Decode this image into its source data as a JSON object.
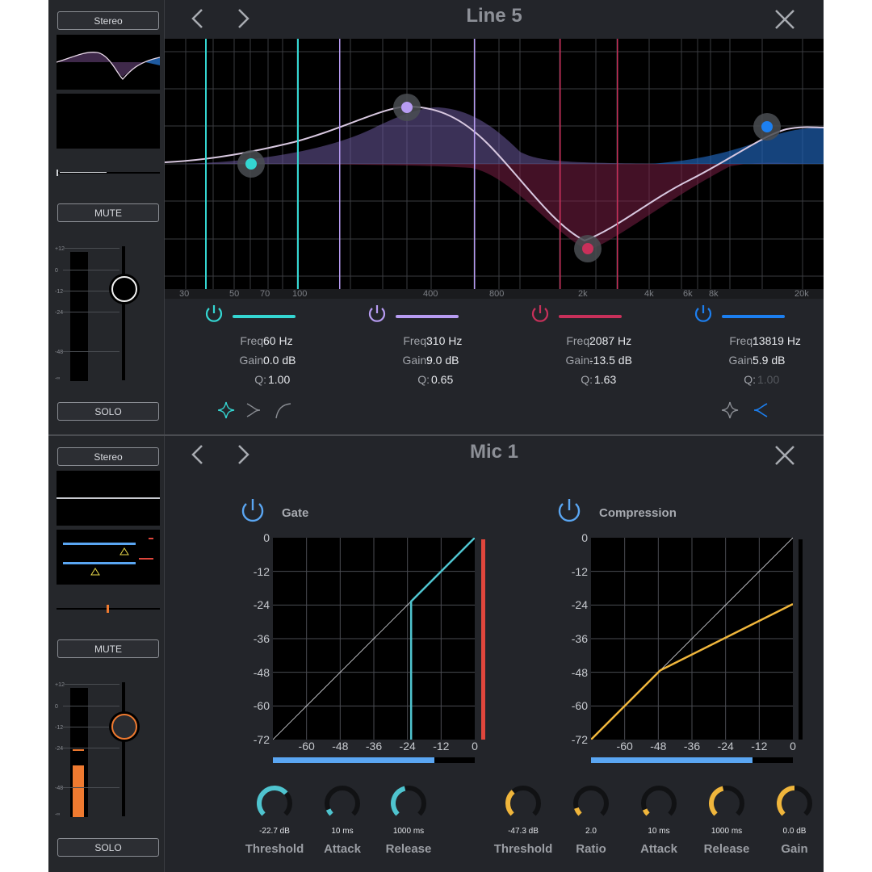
{
  "top": {
    "title": "Line 5",
    "strip": {
      "stereo": "Stereo",
      "mute": "MUTE",
      "solo": "SOLO",
      "scale": [
        "+12",
        "0",
        "-12",
        "-24",
        "-48",
        "-∞"
      ]
    },
    "eq": {
      "freq_ticks": [
        "30",
        "50",
        "70",
        "100",
        "400",
        "800",
        "2k",
        "4k",
        "6k",
        "8k",
        "20k"
      ],
      "bands": [
        {
          "color": "#34d6d2",
          "freq": "60 Hz",
          "gain": "0.0 dB",
          "q": "1.00"
        },
        {
          "color": "#b79cf2",
          "freq": "310 Hz",
          "gain": "9.0 dB",
          "q": "0.65"
        },
        {
          "color": "#c8305a",
          "freq": "2087 Hz",
          "gain": "-13.5 dB",
          "q": "1.63"
        },
        {
          "color": "#1c7ff0",
          "freq": "13819 Hz",
          "gain": "5.9 dB",
          "q": "1.00"
        }
      ],
      "labels": {
        "freq": "Freq:",
        "gain": "Gain:",
        "q": "Q:"
      }
    }
  },
  "bottom": {
    "title": "Mic 1",
    "strip": {
      "stereo": "Stereo",
      "mute": "MUTE",
      "solo": "SOLO",
      "scale": [
        "+12",
        "0",
        "-12",
        "-24",
        "-48",
        "-∞"
      ]
    },
    "gate": {
      "label": "Gate",
      "y_ticks": [
        "0",
        "-12",
        "-24",
        "-36",
        "-48",
        "-60",
        "-72"
      ],
      "x_ticks": [
        "-60",
        "-48",
        "-36",
        "-24",
        "-12",
        "0"
      ],
      "threshold_db": -22.7,
      "knobs": [
        {
          "value": "-22.7 dB",
          "label": "Threshold",
          "level": 0.68
        },
        {
          "value": "10 ms",
          "label": "Attack",
          "level": 0.08
        },
        {
          "value": "1000 ms",
          "label": "Release",
          "level": 0.45
        }
      ]
    },
    "compression": {
      "label": "Compression",
      "y_ticks": [
        "0",
        "-12",
        "-24",
        "-36",
        "-48",
        "-60",
        "-72"
      ],
      "x_ticks": [
        "-60",
        "-48",
        "-36",
        "-24",
        "-12",
        "0"
      ],
      "threshold_db": -47.3,
      "knobs": [
        {
          "value": "-47.3  dB",
          "label": "Threshold",
          "level": 0.35
        },
        {
          "value": "2.0",
          "label": "Ratio",
          "level": 0.1
        },
        {
          "value": "10  ms",
          "label": "Attack",
          "level": 0.08
        },
        {
          "value": "1000 ms",
          "label": "Release",
          "level": 0.45
        },
        {
          "value": "0.0 dB",
          "label": "Gain",
          "level": 0.5
        }
      ]
    }
  },
  "colors": {
    "gate": "#4fc4cf",
    "comp": "#f0b63c",
    "meter_red": "#e0463c",
    "meter_blue": "#5aa6f2",
    "orange": "#ef7a30"
  }
}
